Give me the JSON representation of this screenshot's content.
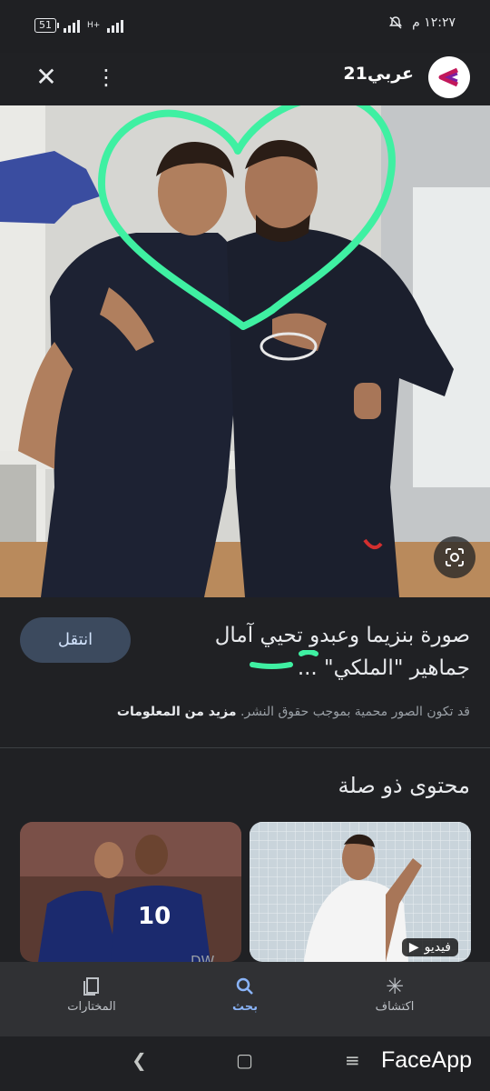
{
  "status_bar": {
    "battery": "51",
    "network": "H+",
    "time": "١٢:٢٧ م"
  },
  "top_bar": {
    "source_name": "عربي21",
    "close_icon": "close-icon",
    "menu_icon": "more-vert-icon"
  },
  "result": {
    "title": "صورة بنزيما وعبدو تحيي آمال جماهير \"الملكي\" ...",
    "visit_label": "انتقل",
    "notice": "قد تكون الصور محمية بموجب حقوق النشر.",
    "more_info": "مزيد من المعلومات"
  },
  "related": {
    "title": "محتوى ذو صلة",
    "cards": [
      {
        "badge": "فيديو"
      },
      {
        "source": "DW"
      }
    ]
  },
  "bottom_nav": {
    "items": [
      {
        "label": "اكتشاف",
        "icon": "asterisk-icon"
      },
      {
        "label": "بحث",
        "icon": "search-icon"
      },
      {
        "label": "المختارات",
        "icon": "collections-icon"
      }
    ]
  },
  "system_nav": {
    "watermark": "FaceApp"
  },
  "colors": {
    "background": "#202124",
    "nav_bar": "#303134",
    "accent": "#8ab4f8",
    "visit_button": "#3c4a5e",
    "heart_stroke": "#3ff0a2"
  }
}
